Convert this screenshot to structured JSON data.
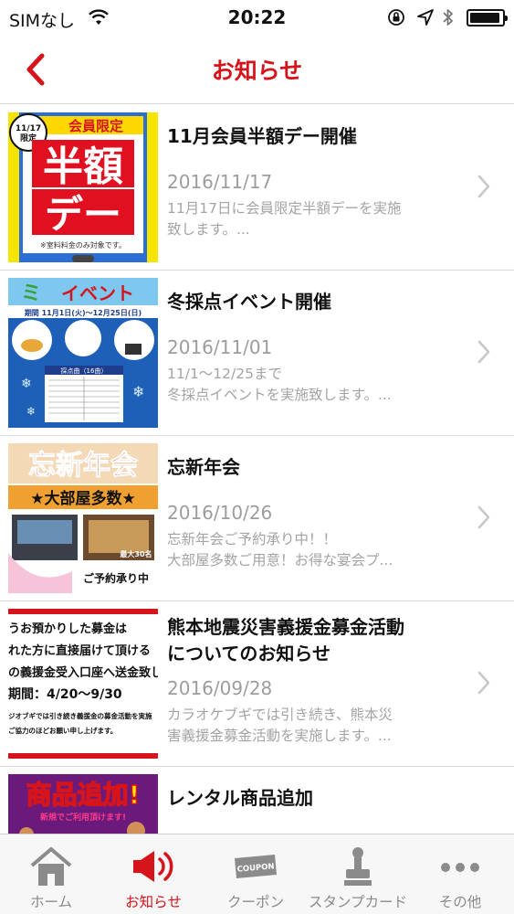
{
  "status_bar": {
    "carrier": "SIMなし",
    "time": "20:22",
    "battery_level": 0.95
  },
  "nav": {
    "title": "お知らせ",
    "back_icon": "chevron-left-icon"
  },
  "news": [
    {
      "title": "11月会員半額デー開催",
      "date": "2016/11/17",
      "excerpt_lines": [
        "11月17日に会員限定半額デーを実施",
        "致します。..."
      ],
      "thumb": {
        "badge": "11/17 限定",
        "top": "会員限定",
        "big1": "半額",
        "big2": "デー",
        "note": "※室料料金のみ対象です。"
      }
    },
    {
      "title": "冬採点イベント開催",
      "date": "2016/11/01",
      "excerpt_lines": [
        "11/1～12/25まで",
        "冬採点イベントを実施致します。..."
      ],
      "thumb": {
        "head": "イベント",
        "period": "期間 11月1日(火)～12月25日(日)",
        "table_head": "採点曲（16曲）"
      }
    },
    {
      "title": "忘新年会",
      "date": "2016/10/26",
      "excerpt_lines": [
        "忘新年会ご予約承り中！！",
        "大部屋多数ご用意！お得な宴会プ..."
      ],
      "thumb": {
        "head": "忘新年会",
        "sub": "★大部屋多数★",
        "cap": "最大30名",
        "foot": "ご予約承り中"
      }
    },
    {
      "title": "熊本地震災害義援金募金活動についてのお知らせ",
      "title_lines": [
        "熊本地震災害義援金募金活動",
        "についてのお知らせ"
      ],
      "date": "2016/09/28",
      "excerpt_lines": [
        "カラオケブギでは引き続き、熊本災",
        "害義援金募金活動を実施します。..."
      ],
      "thumb": {
        "l1": "うお預かりした募金は",
        "l2": "れた方に直接届けて頂ける",
        "l3": "の義援金受入口座へ送金致し",
        "l4": "期間：4/20～9/30",
        "l5": "ジオブギでは引き続き義援金の募金活動を実施",
        "l6": "ご協力のほどお願い申し上げます。"
      }
    },
    {
      "title": "レンタル商品追加",
      "date": "",
      "excerpt_lines": [],
      "thumb": {
        "head": "商品追加!",
        "sub": "新規でご利用頂けます!"
      }
    }
  ],
  "tabs": [
    {
      "label": "ホーム",
      "icon": "home-icon",
      "active": false
    },
    {
      "label": "お知らせ",
      "icon": "megaphone-icon",
      "active": true
    },
    {
      "label": "クーポン",
      "icon": "coupon-icon",
      "active": false,
      "icon_text": "COUPON"
    },
    {
      "label": "スタンプカード",
      "icon": "stamp-icon",
      "active": false
    },
    {
      "label": "その他",
      "icon": "more-icon",
      "active": false
    }
  ],
  "colors": {
    "accent": "#d6141c",
    "inactive": "#8b8b8b",
    "muted_text": "#9d9d9d"
  }
}
